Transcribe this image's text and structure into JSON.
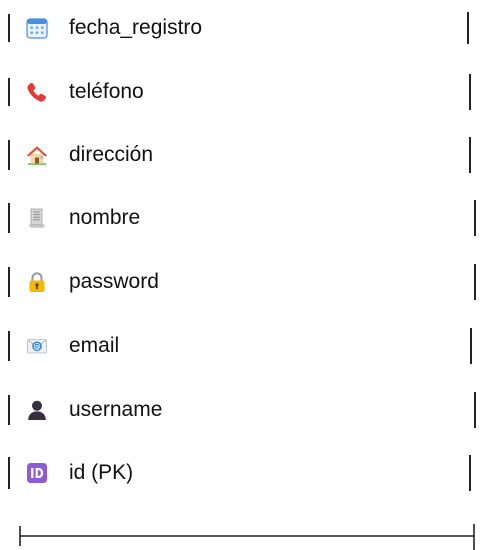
{
  "entity": {
    "fields": [
      {
        "label": "fecha_registro",
        "icon": "calendar-icon"
      },
      {
        "label": "teléfono",
        "icon": "telephone-icon"
      },
      {
        "label": "dirección",
        "icon": "house-icon"
      },
      {
        "label": "nombre",
        "icon": "document-icon"
      },
      {
        "label": "password",
        "icon": "lock-icon"
      },
      {
        "label": "email",
        "icon": "email-envelope-icon"
      },
      {
        "label": "username",
        "icon": "user-silhouette-icon"
      },
      {
        "label": "id (PK)",
        "icon": "id-badge-icon"
      }
    ]
  },
  "colors": {
    "line": "#222222",
    "text": "#111111",
    "id_badge": "#8e5bd6",
    "phone": "#e53935"
  }
}
